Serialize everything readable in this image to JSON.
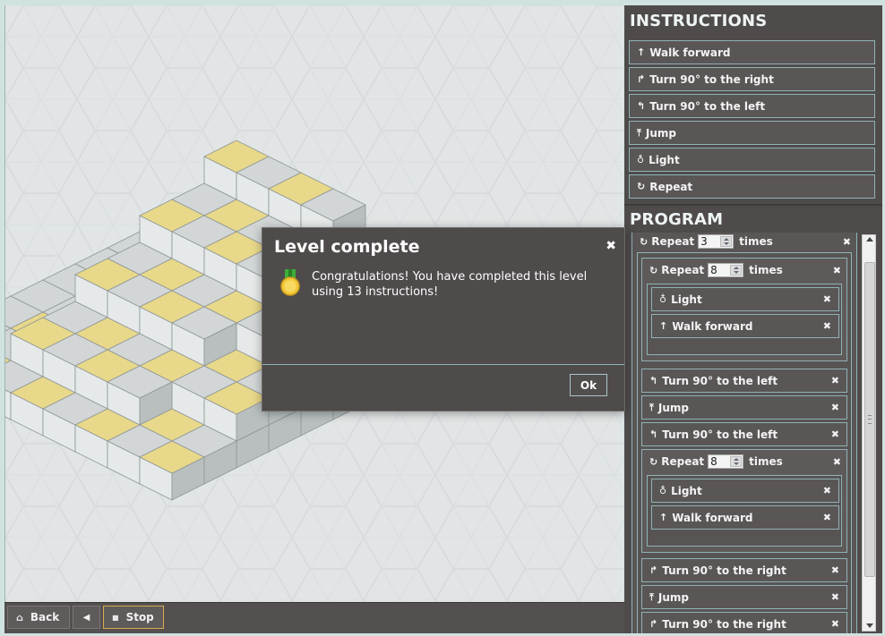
{
  "bottom_bar": {
    "back_label": "Back",
    "stop_label": "Stop"
  },
  "instructions": {
    "title": "INSTRUCTIONS",
    "items": [
      {
        "label": "Walk forward",
        "icon": "arrow-up-icon"
      },
      {
        "label": "Turn 90° to the right",
        "icon": "turn-right-icon"
      },
      {
        "label": "Turn 90° to the left",
        "icon": "turn-left-icon"
      },
      {
        "label": "Jump",
        "icon": "jump-icon"
      },
      {
        "label": "Light",
        "icon": "bulb-icon"
      },
      {
        "label": "Repeat",
        "icon": "repeat-icon"
      }
    ]
  },
  "program": {
    "title": "PROGRAM",
    "repeat_label": "Repeat",
    "times_label": "times",
    "outer_repeat_count": "3",
    "inner_repeat_1_count": "8",
    "inner_repeat_2_count": "8",
    "light_label": "Light",
    "walk_label": "Walk forward",
    "turn_left_label": "Turn 90° to the left",
    "turn_right_label": "Turn 90° to the right",
    "jump_label": "Jump"
  },
  "dialog": {
    "title": "Level complete",
    "message": "Congratulations! You have completed this level using 13 instructions!",
    "ok_label": "Ok"
  },
  "colors": {
    "panel_bg": "#4f4b4b",
    "item_border": "#8fb2b5",
    "lit_tile": "#e8d88a",
    "stop_border": "#d7ad4d"
  }
}
